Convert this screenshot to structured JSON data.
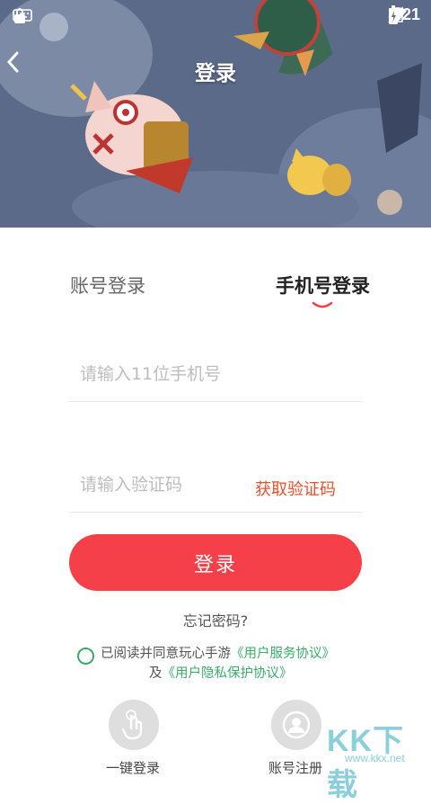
{
  "status_bar": {
    "time": "5:21",
    "icons": [
      "keyboard-icon",
      "lock-icon",
      "wifi-icon",
      "signal-icon",
      "battery-icon"
    ]
  },
  "nav": {
    "title": "登录",
    "back_icon": "chevron-left-icon"
  },
  "tabs": [
    {
      "label": "账号登录",
      "active": false
    },
    {
      "label": "手机号登录",
      "active": true
    }
  ],
  "form": {
    "phone_placeholder": "请输入11位手机号",
    "code_placeholder": "请输入验证码",
    "get_code_label": "获取验证码",
    "login_label": "登录",
    "forgot_label": "忘记密码?"
  },
  "agreement": {
    "prefix": "已阅读并同意玩心手游",
    "service_link": "《用户服务协议》",
    "joiner": "及",
    "privacy_link": "《用户隐私保护协议》"
  },
  "quick_actions": [
    {
      "label": "一键登录",
      "icon": "tap-hand-icon"
    },
    {
      "label": "账号注册",
      "icon": "user-icon"
    }
  ],
  "watermark": {
    "logo": "KK下载",
    "url": "www.kkx.net"
  },
  "colors": {
    "accent_red": "#f5404a",
    "code_orange": "#e8502c",
    "link_green": "#3cab6a"
  }
}
